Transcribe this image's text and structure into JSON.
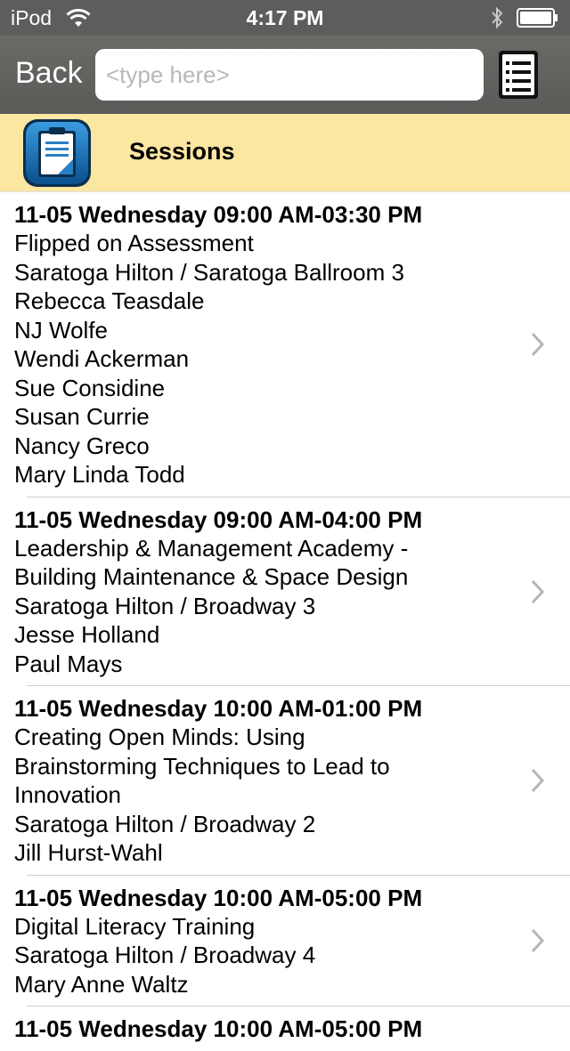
{
  "status_bar": {
    "carrier": "iPod",
    "time": "4:17 PM"
  },
  "nav": {
    "back_label": "Back",
    "search_placeholder": "<type here>",
    "search_value": ""
  },
  "header": {
    "title": "Sessions"
  },
  "sessions": [
    {
      "time": "11-05 Wednesday 09:00 AM-03:30 PM",
      "lines": [
        "Flipped on Assessment",
        "Saratoga Hilton / Saratoga Ballroom 3",
        "Rebecca Teasdale",
        "NJ Wolfe",
        "Wendi Ackerman",
        "Sue Considine",
        "Susan Currie",
        "Nancy Greco",
        "Mary Linda Todd"
      ]
    },
    {
      "time": "11-05 Wednesday 09:00 AM-04:00 PM",
      "lines": [
        "Leadership & Management Academy -",
        "Building Maintenance & Space Design",
        "Saratoga Hilton / Broadway 3",
        "Jesse Holland",
        "Paul Mays"
      ]
    },
    {
      "time": "11-05 Wednesday 10:00 AM-01:00 PM",
      "lines": [
        "Creating Open Minds: Using",
        "Brainstorming Techniques to Lead to",
        "Innovation",
        "Saratoga Hilton / Broadway 2",
        "Jill Hurst-Wahl"
      ]
    },
    {
      "time": "11-05 Wednesday 10:00 AM-05:00 PM",
      "lines": [
        "Digital Literacy Training",
        "Saratoga Hilton / Broadway 4",
        "Mary Anne Waltz"
      ]
    },
    {
      "time": "11-05 Wednesday 10:00 AM-05:00 PM",
      "lines": []
    }
  ]
}
